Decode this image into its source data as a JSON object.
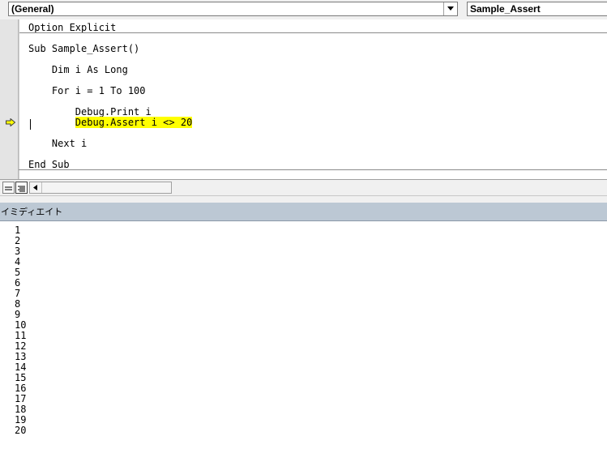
{
  "combo_bar": {
    "object_combo": "(General)",
    "procedure_combo": "Sample_Assert"
  },
  "code": {
    "option_line": "Option Explicit",
    "lines": [
      "Sub Sample_Assert()",
      "    Dim i As Long",
      "    For i = 1 To 100",
      "        Debug.Print i",
      "        Debug.Assert i <> 20",
      "    Next i",
      "End Sub"
    ],
    "current_statement": "Debug.Assert i <> 20",
    "highlight_color": "#ffff00"
  },
  "immediate": {
    "title": "イミディエイト",
    "output": [
      "1",
      "2",
      "3",
      "4",
      "5",
      "6",
      "7",
      "8",
      "9",
      "10",
      "11",
      "12",
      "13",
      "14",
      "15",
      "16",
      "17",
      "18",
      "19",
      "20"
    ]
  },
  "icons": {
    "execution_pointer": "yellow-arrow-icon",
    "procedure_view": "procedure-view-icon",
    "full_module_view": "full-module-view-icon",
    "scroll_left": "scroll-left-icon",
    "dropdown": "chevron-down-icon"
  }
}
